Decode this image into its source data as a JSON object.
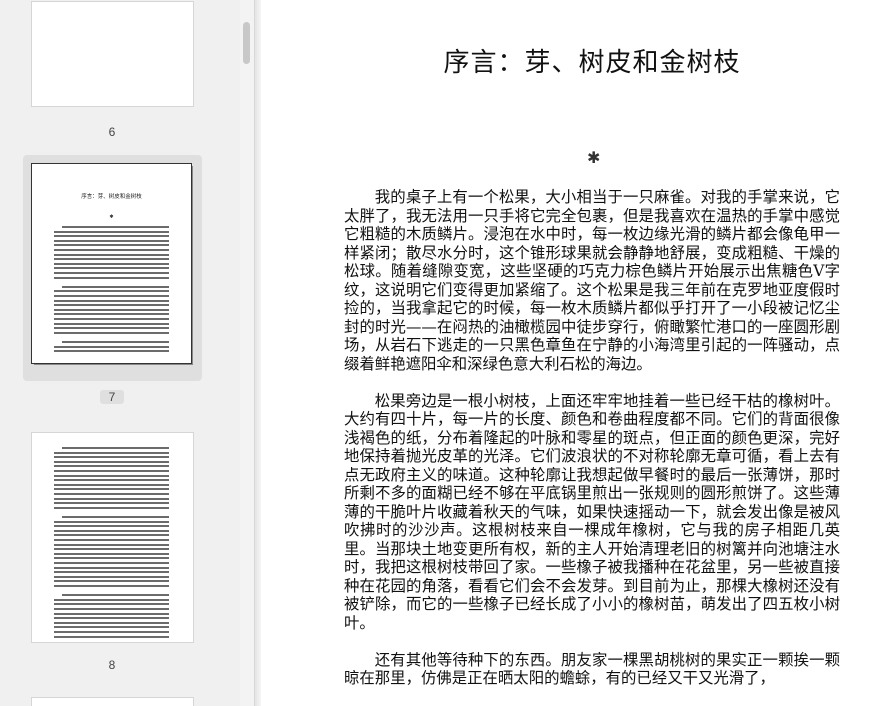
{
  "thumbnails": [
    {
      "page_label": "6"
    },
    {
      "page_label": "7",
      "title": "序言：芽、树皮和金树枝",
      "ornament": "✱",
      "selected": true
    },
    {
      "page_label": "8"
    }
  ],
  "document": {
    "title": "序言：芽、树皮和金树枝",
    "ornament": "✱",
    "paragraphs": [
      "我的桌子上有一个松果，大小相当于一只麻雀。对我的手掌来说，它太胖了，我无法用一只手将它完全包裹，但是我喜欢在温热的手掌中感觉它粗糙的木质鳞片。浸泡在水中时，每一枚边缘光滑的鳞片都会像龟甲一样紧闭；散尽水分时，这个锥形球果就会静静地舒展，变成粗糙、干燥的松球。随着缝隙变宽，这些坚硬的巧克力棕色鳞片开始展示出焦糖色V字纹，这说明它们变得更加紧缩了。这个松果是我三年前在克罗地亚度假时捡的，当我拿起它的时候，每一枚木质鳞片都似乎打开了一小段被记忆尘封的时光——在闷热的油橄榄园中徒步穿行，俯瞰繁忙港口的一座圆形剧场，从岩石下逃走的一只黑色章鱼在宁静的小海湾里引起的一阵骚动，点缀着鲜艳遮阳伞和深绿色意大利石松的海边。",
      "松果旁边是一根小树枝，上面还牢牢地挂着一些已经干枯的橡树叶。大约有四十片，每一片的长度、颜色和卷曲程度都不同。它们的背面很像浅褐色的纸，分布着隆起的叶脉和零星的斑点，但正面的颜色更深，完好地保持着抛光皮革的光泽。它们波浪状的不对称轮廓无章可循，看上去有点无政府主义的味道。这种轮廓让我想起做早餐时的最后一张薄饼，那时所剩不多的面糊已经不够在平底锅里煎出一张规则的圆形煎饼了。这些薄薄的干脆叶片收藏着秋天的气味，如果快速摇动一下，就会发出像是被风吹拂时的沙沙声。这根树枝来自一棵成年橡树，它与我的房子相距几英里。当那块土地变更所有权，新的主人开始清理老旧的树篱并向池塘注水时，我把这根树枝带回了家。一些橡子被我播种在花盆里，另一些被直接种在花园的角落，看看它们会不会发芽。到目前为止，那棵大橡树还没有被铲除，而它的一些橡子已经长成了小小的橡树苗，萌发出了四五枚小树叶。",
      "还有其他等待种下的东西。朋友家一棵黑胡桃树的果实正一颗挨一颗晾在那里，仿佛是正在晒太阳的蟾蜍，有的已经又干又光滑了，"
    ]
  }
}
